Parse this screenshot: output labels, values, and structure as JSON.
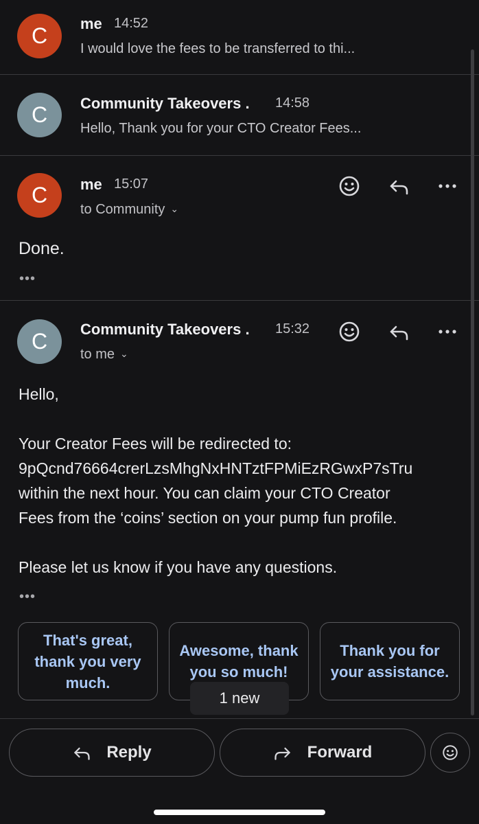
{
  "messages": [
    {
      "avatar_letter": "C",
      "sender": "me",
      "time": "14:52",
      "snippet": "I would love the fees to be transferred to thi..."
    },
    {
      "avatar_letter": "C",
      "sender": "Community Takeovers .",
      "time": "14:58",
      "snippet": "Hello, Thank you for your CTO Creator Fees..."
    },
    {
      "avatar_letter": "C",
      "sender": "me",
      "time": "15:07",
      "recipient": "to Community",
      "body": "Done.",
      "more": "•••"
    },
    {
      "avatar_letter": "C",
      "sender": "Community Takeovers .",
      "time": "15:32",
      "recipient": "to me",
      "body_lines": [
        "Hello,",
        "Your Creator Fees will be redirected to:",
        "9pQcnd76664crerLzsMhgNxHNTztFPMiEzRGwxP7sTru",
        "within the next hour. You can claim your CTO Creator",
        "Fees from the ‘coins’ section on your pump fun profile.",
        "Please let us know if you have any questions."
      ],
      "more": "•••"
    }
  ],
  "smart_replies": [
    "That's great, thank you very much.",
    "Awesome, thank you so much!",
    "Thank you for your assistance."
  ],
  "toast": "1 new",
  "bottom_bar": {
    "reply_label": "Reply",
    "forward_label": "Forward"
  },
  "icons": {
    "emoji": "emoji-icon",
    "reply": "reply-icon",
    "more": "more-icon",
    "forward": "forward-icon"
  },
  "colors": {
    "background": "#141416",
    "avatar_me": "#c5401c",
    "avatar_community": "#7b929b",
    "smart_reply_text": "#a9c7f4"
  }
}
